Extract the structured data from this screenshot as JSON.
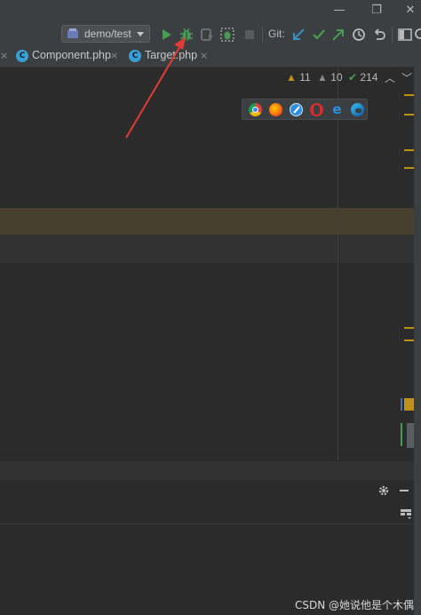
{
  "toolbar": {
    "run_config_label": "demo/test",
    "git_label": "Git:"
  },
  "tabs": [
    {
      "label": "Component.php",
      "icon": "C"
    },
    {
      "label": "Target.php",
      "icon": "C"
    }
  ],
  "inspections": {
    "warnings": "11",
    "weak_warnings": "10",
    "typos": "214"
  },
  "browsers": [
    "chrome-icon",
    "firefox-icon",
    "safari-icon",
    "opera-icon",
    "ie-icon",
    "edge-icon"
  ],
  "watermark": "CSDN @她说他是个木偶",
  "colors": {
    "background": "#2b2b2b",
    "toolbar": "#3c3f41",
    "run_green": "#499c54",
    "git_blue": "#3592c4",
    "warning_yellow": "#be9117",
    "annotation_red": "#e53935"
  }
}
